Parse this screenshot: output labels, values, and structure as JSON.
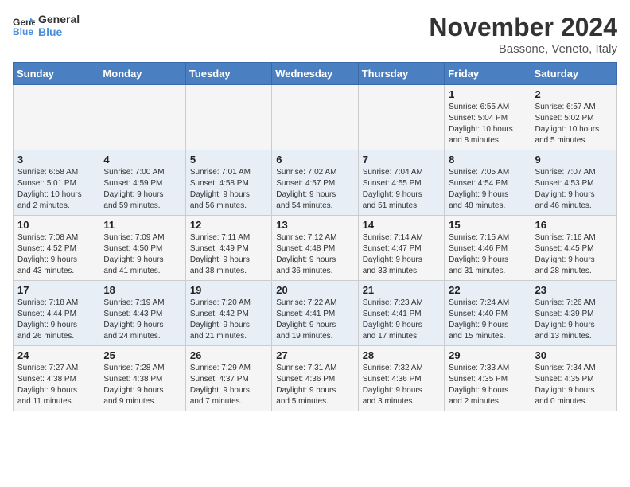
{
  "header": {
    "logo_line1": "General",
    "logo_line2": "Blue",
    "month": "November 2024",
    "location": "Bassone, Veneto, Italy"
  },
  "weekdays": [
    "Sunday",
    "Monday",
    "Tuesday",
    "Wednesday",
    "Thursday",
    "Friday",
    "Saturday"
  ],
  "weeks": [
    [
      {
        "day": "",
        "info": ""
      },
      {
        "day": "",
        "info": ""
      },
      {
        "day": "",
        "info": ""
      },
      {
        "day": "",
        "info": ""
      },
      {
        "day": "",
        "info": ""
      },
      {
        "day": "1",
        "info": "Sunrise: 6:55 AM\nSunset: 5:04 PM\nDaylight: 10 hours\nand 8 minutes."
      },
      {
        "day": "2",
        "info": "Sunrise: 6:57 AM\nSunset: 5:02 PM\nDaylight: 10 hours\nand 5 minutes."
      }
    ],
    [
      {
        "day": "3",
        "info": "Sunrise: 6:58 AM\nSunset: 5:01 PM\nDaylight: 10 hours\nand 2 minutes."
      },
      {
        "day": "4",
        "info": "Sunrise: 7:00 AM\nSunset: 4:59 PM\nDaylight: 9 hours\nand 59 minutes."
      },
      {
        "day": "5",
        "info": "Sunrise: 7:01 AM\nSunset: 4:58 PM\nDaylight: 9 hours\nand 56 minutes."
      },
      {
        "day": "6",
        "info": "Sunrise: 7:02 AM\nSunset: 4:57 PM\nDaylight: 9 hours\nand 54 minutes."
      },
      {
        "day": "7",
        "info": "Sunrise: 7:04 AM\nSunset: 4:55 PM\nDaylight: 9 hours\nand 51 minutes."
      },
      {
        "day": "8",
        "info": "Sunrise: 7:05 AM\nSunset: 4:54 PM\nDaylight: 9 hours\nand 48 minutes."
      },
      {
        "day": "9",
        "info": "Sunrise: 7:07 AM\nSunset: 4:53 PM\nDaylight: 9 hours\nand 46 minutes."
      }
    ],
    [
      {
        "day": "10",
        "info": "Sunrise: 7:08 AM\nSunset: 4:52 PM\nDaylight: 9 hours\nand 43 minutes."
      },
      {
        "day": "11",
        "info": "Sunrise: 7:09 AM\nSunset: 4:50 PM\nDaylight: 9 hours\nand 41 minutes."
      },
      {
        "day": "12",
        "info": "Sunrise: 7:11 AM\nSunset: 4:49 PM\nDaylight: 9 hours\nand 38 minutes."
      },
      {
        "day": "13",
        "info": "Sunrise: 7:12 AM\nSunset: 4:48 PM\nDaylight: 9 hours\nand 36 minutes."
      },
      {
        "day": "14",
        "info": "Sunrise: 7:14 AM\nSunset: 4:47 PM\nDaylight: 9 hours\nand 33 minutes."
      },
      {
        "day": "15",
        "info": "Sunrise: 7:15 AM\nSunset: 4:46 PM\nDaylight: 9 hours\nand 31 minutes."
      },
      {
        "day": "16",
        "info": "Sunrise: 7:16 AM\nSunset: 4:45 PM\nDaylight: 9 hours\nand 28 minutes."
      }
    ],
    [
      {
        "day": "17",
        "info": "Sunrise: 7:18 AM\nSunset: 4:44 PM\nDaylight: 9 hours\nand 26 minutes."
      },
      {
        "day": "18",
        "info": "Sunrise: 7:19 AM\nSunset: 4:43 PM\nDaylight: 9 hours\nand 24 minutes."
      },
      {
        "day": "19",
        "info": "Sunrise: 7:20 AM\nSunset: 4:42 PM\nDaylight: 9 hours\nand 21 minutes."
      },
      {
        "day": "20",
        "info": "Sunrise: 7:22 AM\nSunset: 4:41 PM\nDaylight: 9 hours\nand 19 minutes."
      },
      {
        "day": "21",
        "info": "Sunrise: 7:23 AM\nSunset: 4:41 PM\nDaylight: 9 hours\nand 17 minutes."
      },
      {
        "day": "22",
        "info": "Sunrise: 7:24 AM\nSunset: 4:40 PM\nDaylight: 9 hours\nand 15 minutes."
      },
      {
        "day": "23",
        "info": "Sunrise: 7:26 AM\nSunset: 4:39 PM\nDaylight: 9 hours\nand 13 minutes."
      }
    ],
    [
      {
        "day": "24",
        "info": "Sunrise: 7:27 AM\nSunset: 4:38 PM\nDaylight: 9 hours\nand 11 minutes."
      },
      {
        "day": "25",
        "info": "Sunrise: 7:28 AM\nSunset: 4:38 PM\nDaylight: 9 hours\nand 9 minutes."
      },
      {
        "day": "26",
        "info": "Sunrise: 7:29 AM\nSunset: 4:37 PM\nDaylight: 9 hours\nand 7 minutes."
      },
      {
        "day": "27",
        "info": "Sunrise: 7:31 AM\nSunset: 4:36 PM\nDaylight: 9 hours\nand 5 minutes."
      },
      {
        "day": "28",
        "info": "Sunrise: 7:32 AM\nSunset: 4:36 PM\nDaylight: 9 hours\nand 3 minutes."
      },
      {
        "day": "29",
        "info": "Sunrise: 7:33 AM\nSunset: 4:35 PM\nDaylight: 9 hours\nand 2 minutes."
      },
      {
        "day": "30",
        "info": "Sunrise: 7:34 AM\nSunset: 4:35 PM\nDaylight: 9 hours\nand 0 minutes."
      }
    ]
  ]
}
